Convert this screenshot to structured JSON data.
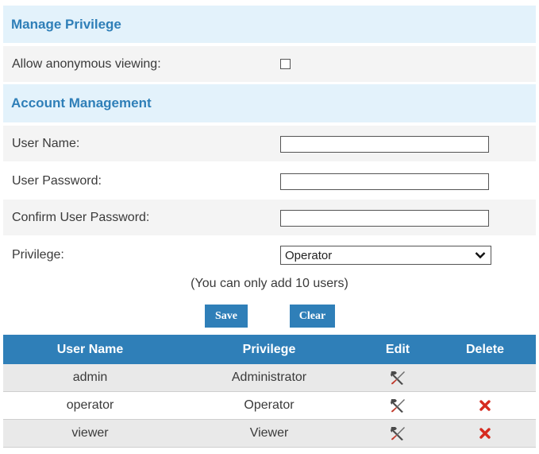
{
  "manage_privilege": {
    "title": "Manage Privilege",
    "anonymous_label": "Allow anonymous viewing:",
    "anonymous_checked": false
  },
  "account_management": {
    "title": "Account Management",
    "user_name_label": "User Name:",
    "user_name_value": "",
    "user_password_label": "User Password:",
    "user_password_value": "",
    "confirm_password_label": "Confirm User Password:",
    "confirm_password_value": "",
    "privilege_label": "Privilege:",
    "privilege_selected": "Operator",
    "note": "(You can only add 10 users)",
    "save_label": "Save",
    "clear_label": "Clear"
  },
  "colors": {
    "accent": "#2f7fb8",
    "section_bg": "#e3f2fb",
    "delete_red": "#d62a1f"
  },
  "user_table": {
    "headers": [
      "User Name",
      "Privilege",
      "Edit",
      "Delete"
    ],
    "rows": [
      {
        "user": "admin",
        "privilege": "Administrator",
        "editable": true,
        "deletable": false
      },
      {
        "user": "operator",
        "privilege": "Operator",
        "editable": true,
        "deletable": true
      },
      {
        "user": "viewer",
        "privilege": "Viewer",
        "editable": true,
        "deletable": true
      }
    ],
    "edit_icon": "tools-icon",
    "delete_icon": "red-x-icon"
  }
}
